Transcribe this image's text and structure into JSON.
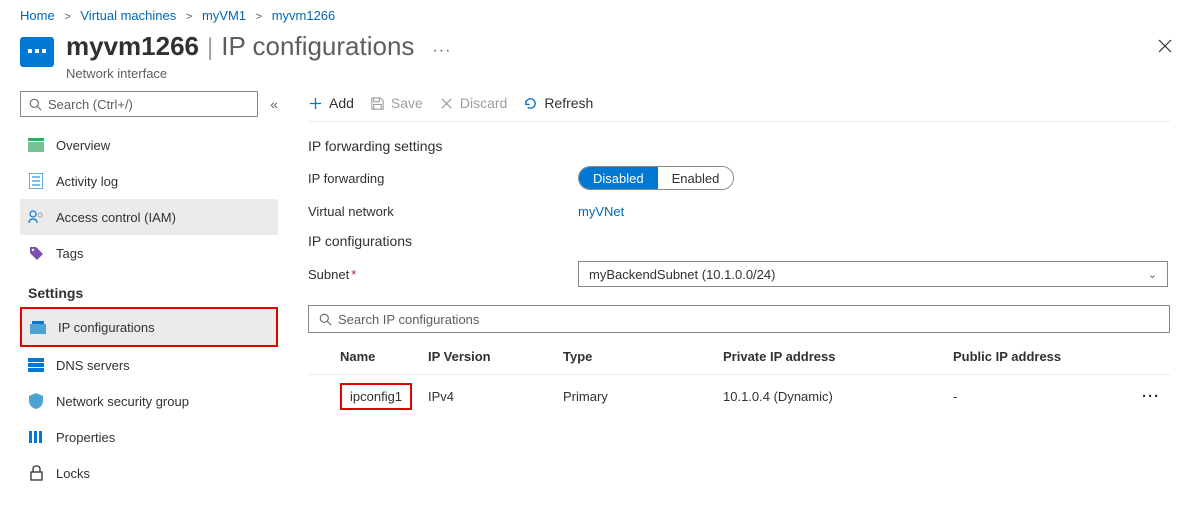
{
  "breadcrumb": [
    {
      "label": "Home"
    },
    {
      "label": "Virtual machines"
    },
    {
      "label": "myVM1"
    },
    {
      "label": "myvm1266"
    }
  ],
  "header": {
    "title": "myvm1266",
    "section": "IP configurations",
    "subtitle": "Network interface"
  },
  "sidebar": {
    "search_placeholder": "Search (Ctrl+/)",
    "items_top": [
      {
        "label": "Overview",
        "icon": "overview"
      },
      {
        "label": "Activity log",
        "icon": "log"
      },
      {
        "label": "Access control (IAM)",
        "icon": "iam"
      },
      {
        "label": "Tags",
        "icon": "tags"
      }
    ],
    "section_label": "Settings",
    "items_settings": [
      {
        "label": "IP configurations",
        "icon": "ipconfig"
      },
      {
        "label": "DNS servers",
        "icon": "dns"
      },
      {
        "label": "Network security group",
        "icon": "nsg"
      },
      {
        "label": "Properties",
        "icon": "props"
      },
      {
        "label": "Locks",
        "icon": "locks"
      }
    ]
  },
  "toolbar": {
    "add": "Add",
    "save": "Save",
    "discard": "Discard",
    "refresh": "Refresh"
  },
  "forwarding": {
    "section_title": "IP forwarding settings",
    "label": "IP forwarding",
    "disabled": "Disabled",
    "enabled": "Enabled",
    "vnet_label": "Virtual network",
    "vnet_value": "myVNet"
  },
  "ipconfig": {
    "section_title": "IP configurations",
    "subnet_label": "Subnet",
    "subnet_value": "myBackendSubnet (10.1.0.0/24)",
    "filter_placeholder": "Search IP configurations"
  },
  "table": {
    "headers": {
      "name": "Name",
      "ipver": "IP Version",
      "type": "Type",
      "private": "Private IP address",
      "public": "Public IP address"
    },
    "rows": [
      {
        "name": "ipconfig1",
        "ipver": "IPv4",
        "type": "Primary",
        "private": "10.1.0.4 (Dynamic)",
        "public": "-"
      }
    ]
  }
}
